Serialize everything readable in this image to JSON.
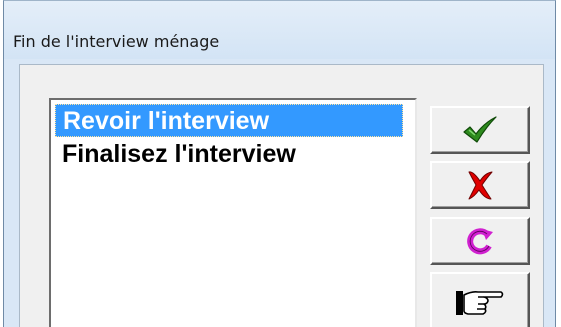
{
  "window": {
    "title": "Fin de l'interview ménage"
  },
  "list": {
    "items": [
      {
        "label": "Revoir l'interview",
        "selected": true
      },
      {
        "label": "Finalisez l'interview",
        "selected": false
      }
    ]
  },
  "buttons": [
    {
      "icon": "checkmark-icon",
      "color": "#2e8b1e"
    },
    {
      "icon": "x-mark-icon",
      "color": "#e00000"
    },
    {
      "icon": "refresh-icon",
      "color": "#d020d0"
    },
    {
      "icon": "pointing-hand-icon",
      "color": "#000000"
    }
  ],
  "colors": {
    "selection": "#3399ff",
    "titlebar": "#d9e7f6",
    "face": "#f0f0f0"
  }
}
